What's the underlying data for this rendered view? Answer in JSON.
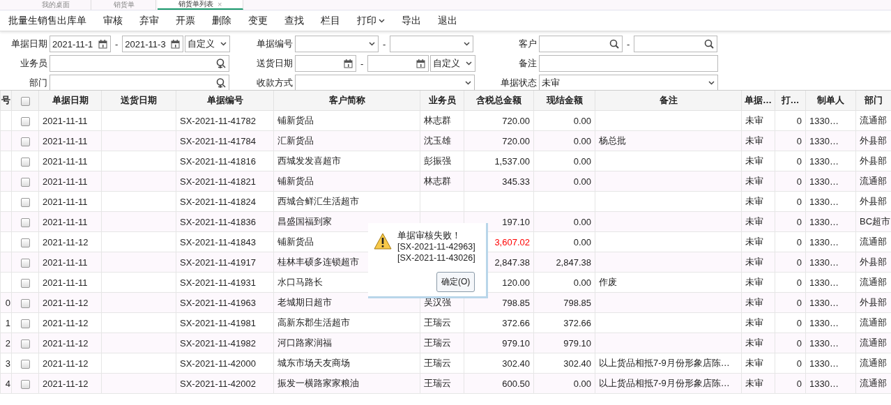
{
  "tabs": [
    {
      "label": "我的桌面",
      "selected": false,
      "closable": false
    },
    {
      "label": "销货单",
      "selected": false,
      "closable": false
    },
    {
      "label": "销货单列表",
      "selected": true,
      "closable": true
    }
  ],
  "close_glyph": "×",
  "toolbar": [
    {
      "label": "批量生销售出库单",
      "dropdown": false
    },
    {
      "label": "审核",
      "dropdown": false
    },
    {
      "label": "弃审",
      "dropdown": false
    },
    {
      "label": "开票",
      "dropdown": false
    },
    {
      "label": "删除",
      "dropdown": false
    },
    {
      "label": "变更",
      "dropdown": false
    },
    {
      "label": "查找",
      "dropdown": false
    },
    {
      "label": "栏目",
      "dropdown": false
    },
    {
      "label": "打印",
      "dropdown": true
    },
    {
      "label": "导出",
      "dropdown": false
    },
    {
      "label": "退出",
      "dropdown": false
    }
  ],
  "filters": [
    [
      {
        "label": "单据日期",
        "controls": [
          {
            "kind": "date",
            "value": "2021-11-1"
          },
          {
            "kind": "date",
            "value": "2021-11-3"
          },
          {
            "kind": "preset",
            "value": "自定义"
          }
        ]
      },
      {
        "label": "单据编号",
        "controls": [
          {
            "kind": "select"
          },
          {
            "kind": "select"
          }
        ]
      },
      {
        "label": "客户",
        "controls": [
          {
            "kind": "lookup"
          },
          {
            "kind": "lookup"
          }
        ]
      }
    ],
    [
      {
        "label": "业务员",
        "controls": [
          {
            "kind": "person"
          }
        ]
      },
      {
        "label": "送货日期",
        "controls": [
          {
            "kind": "date"
          },
          {
            "kind": "date"
          },
          {
            "kind": "preset",
            "value": "自定义"
          }
        ]
      },
      {
        "label": "备注",
        "controls": [
          {
            "kind": "text"
          }
        ]
      }
    ],
    [
      {
        "label": "部门",
        "controls": [
          {
            "kind": "person"
          }
        ]
      },
      {
        "label": "收款方式",
        "controls": [
          {
            "kind": "select"
          }
        ]
      },
      {
        "label": "单据状态",
        "controls": [
          {
            "kind": "select",
            "value": "未审"
          }
        ]
      }
    ]
  ],
  "range_separator": "-",
  "table": {
    "header_checked": false,
    "columns": [
      "号",
      "单据日期",
      "送货日期",
      "单据编号",
      "客户简称",
      "业务员",
      "含税总金额",
      "现结金额",
      "备注",
      "单据…",
      "打…",
      "制单人",
      "部门"
    ],
    "rows": [
      {
        "checked": false,
        "date": "2021-11-11",
        "doc_no": "SX-2021-11-41782",
        "customer": "铺新货品",
        "salesman": "林志群",
        "total": "720.00",
        "cash": "0.00",
        "status": "未审",
        "printed": "0",
        "creator": "1330…",
        "dept": "流通部",
        "alert": false
      },
      {
        "checked": false,
        "date": "2021-11-11",
        "doc_no": "SX-2021-11-41784",
        "customer": "汇新货品",
        "salesman": "沈玉雄",
        "total": "720.00",
        "cash": "0.00",
        "note": "杨总批",
        "status": "未审",
        "printed": "0",
        "creator": "1330…",
        "dept": "外县部",
        "alert": false
      },
      {
        "checked": false,
        "date": "2021-11-11",
        "doc_no": "SX-2021-11-41816",
        "customer": "西城发发喜超市",
        "salesman": "彭振强",
        "total": "1,537.00",
        "cash": "0.00",
        "status": "未审",
        "printed": "0",
        "creator": "1330…",
        "dept": "外县部",
        "alert": false
      },
      {
        "checked": false,
        "date": "2021-11-11",
        "doc_no": "SX-2021-11-41821",
        "customer": "铺新货品",
        "salesman": "林志群",
        "total": "345.33",
        "cash": "0.00",
        "status": "未审",
        "printed": "0",
        "creator": "1330…",
        "dept": "流通部",
        "alert": false
      },
      {
        "checked": false,
        "date": "2021-11-11",
        "doc_no": "SX-2021-11-41824",
        "customer": "西城合鲜汇生活超市",
        "status": "未审",
        "printed": "0",
        "creator": "1330…",
        "dept": "外县部"
      },
      {
        "checked": false,
        "date": "2021-11-11",
        "doc_no": "SX-2021-11-41836",
        "customer": "昌盛国福到家",
        "total": "197.10",
        "cash": "0.00",
        "status": "未审",
        "printed": "0",
        "creator": "1330…",
        "dept": "BC超市",
        "alert": false
      },
      {
        "checked": false,
        "date": "2021-11-12",
        "doc_no": "SX-2021-11-41843",
        "customer": "铺新货品",
        "total": "3,607.02",
        "cash": "0.00",
        "status": "未审",
        "printed": "0",
        "creator": "1330…",
        "dept": "流通部",
        "alert": true
      },
      {
        "checked": false,
        "date": "2021-11-11",
        "doc_no": "SX-2021-11-41917",
        "customer": "桂林丰硕多连锁超市",
        "total": "2,847.38",
        "cash": "2,847.38",
        "status": "未审",
        "printed": "0",
        "creator": "1330…",
        "dept": "外县部",
        "alert": false
      },
      {
        "checked": false,
        "date": "2021-11-11",
        "doc_no": "SX-2021-11-41931",
        "customer": "水口马路长",
        "total": "120.00",
        "cash": "0.00",
        "note": "作废",
        "status": "未审",
        "printed": "0",
        "creator": "1330…",
        "dept": "流通部",
        "alert": false
      },
      {
        "no": "0",
        "checked": false,
        "date": "2021-11-12",
        "doc_no": "SX-2021-11-41963",
        "customer": "老城期日超市",
        "salesman": "吴汉强",
        "total": "798.85",
        "cash": "798.85",
        "status": "未审",
        "printed": "0",
        "creator": "1330…",
        "dept": "外县部",
        "alert": false
      },
      {
        "no": "1",
        "checked": false,
        "date": "2021-11-12",
        "doc_no": "SX-2021-11-41981",
        "customer": "高新东郡生活超市",
        "salesman": "王瑞云",
        "total": "372.66",
        "cash": "372.66",
        "status": "未审",
        "printed": "0",
        "creator": "1330…",
        "dept": "流通部",
        "alert": false
      },
      {
        "no": "2",
        "checked": false,
        "date": "2021-11-12",
        "doc_no": "SX-2021-11-41982",
        "customer": "河口路家润福",
        "salesman": "王瑞云",
        "total": "979.10",
        "cash": "979.10",
        "status": "未审",
        "printed": "0",
        "creator": "1330…",
        "dept": "流通部",
        "alert": false
      },
      {
        "no": "3",
        "checked": false,
        "date": "2021-11-12",
        "doc_no": "SX-2021-11-42000",
        "customer": "城东市场天友商场",
        "salesman": "王瑞云",
        "total": "302.40",
        "cash": "302.40",
        "note": "以上货品相抵7-9月份形象店陈…",
        "status": "未审",
        "printed": "0",
        "creator": "1330…",
        "dept": "流通部",
        "alert": false
      },
      {
        "no": "4",
        "checked": false,
        "date": "2021-11-12",
        "doc_no": "SX-2021-11-42002",
        "customer": "振发一横路家家粮油",
        "salesman": "王瑞云",
        "total": "600.50",
        "cash": "0.00",
        "note": "以上货品相抵7-9月份形象店陈…",
        "status": "未审",
        "printed": "0",
        "creator": "1330…",
        "dept": "流通部",
        "alert": false
      }
    ]
  },
  "dialog": {
    "lines": [
      "单据审核失败！",
      "[SX-2021-11-42963]",
      "[SX-2021-11-43026]"
    ],
    "button": "确定(O)"
  }
}
